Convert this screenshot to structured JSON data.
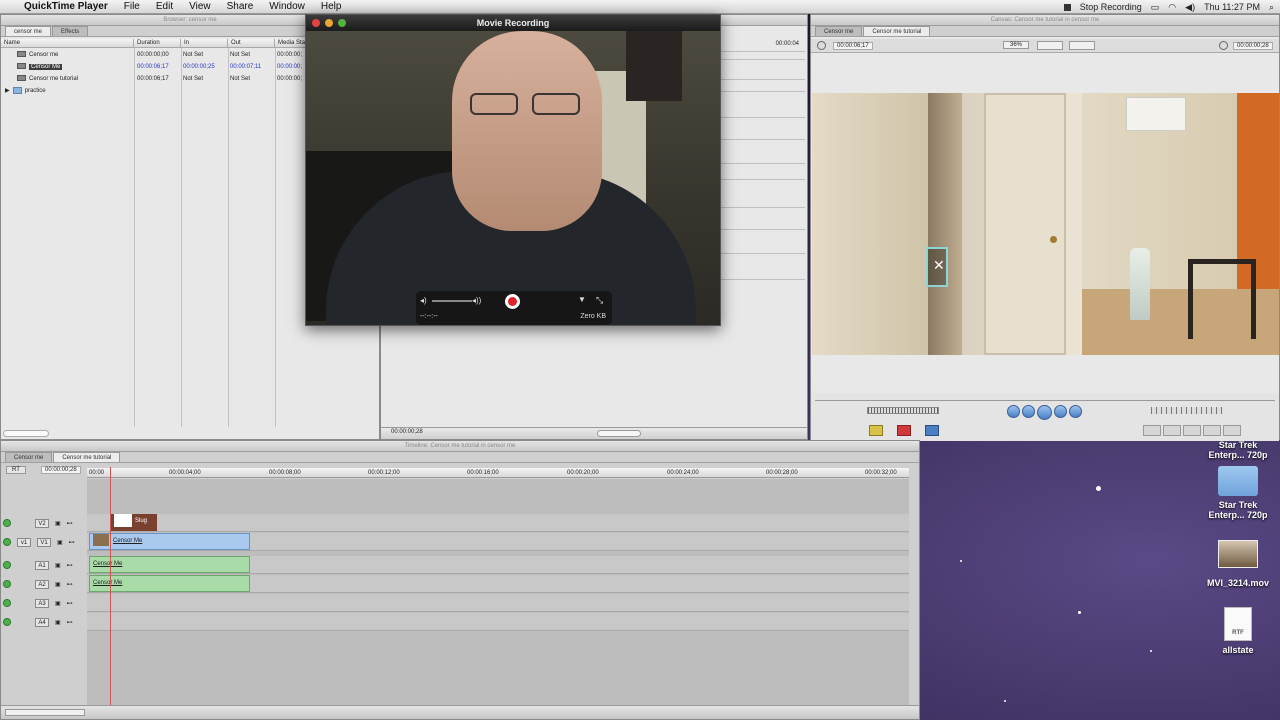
{
  "menubar": {
    "apple": "",
    "items": [
      "QuickTime Player",
      "File",
      "Edit",
      "View",
      "Share",
      "Window",
      "Help"
    ],
    "status": "Stop Recording",
    "clock": "Thu 11:27 PM"
  },
  "browser": {
    "title": "Browser: censor me",
    "tabs": [
      "censor me",
      "Effects"
    ],
    "columns": [
      "Name",
      "Duration",
      "In",
      "Out",
      "Media Start"
    ],
    "rows": [
      {
        "name": "Censor me",
        "duration": "00:00:00;00",
        "in": "Not Set",
        "out": "Not Set",
        "start": "00:00:00;"
      },
      {
        "name": "Censor Me",
        "duration": "00:00:06;17",
        "in": "00:00:00;25",
        "out": "00:00:07;11",
        "start": "00:00:00;"
      },
      {
        "name": "Censor me tutorial",
        "duration": "00:00:06;17",
        "in": "Not Set",
        "out": "Not Set",
        "start": "00:00:00;"
      },
      {
        "name": "practice",
        "duration": "",
        "in": "",
        "out": "",
        "start": ""
      }
    ]
  },
  "viewer": {
    "timecode_top": "00:00:04",
    "timecode_bottom": "00:00:00;28"
  },
  "canvas": {
    "title": "Canvas: Censor me tutorial in censor me",
    "tabs": [
      "Censor me",
      "Censor me tutorial"
    ],
    "timecode_left": "00:00:06;17",
    "zoom": "36%",
    "timecode_right": "00:00:00;28"
  },
  "quicktime": {
    "title": "Movie Recording",
    "time": "--:--:--",
    "size": "Zero KB"
  },
  "timeline": {
    "title": "Timeline: Censor me tutorial in censor me",
    "tabs": [
      "Censor me",
      "Censor me tutorial"
    ],
    "rt": "RT",
    "timecode": "00:00:00;28",
    "ticks": [
      "00:00",
      "00:00:04;00",
      "00:00:08;00",
      "00:00:12;00",
      "00:00:16;00",
      "00:00:20;00",
      "00:00:24;00",
      "00:00:28;00",
      "00:00:32;00"
    ],
    "tracks": [
      "V2",
      "V1",
      "A1",
      "A2",
      "A3",
      "A4"
    ],
    "v1_label": "v1",
    "clips": {
      "slug": "Slug",
      "video": "Censor Me",
      "audio1": "Censor Me",
      "audio2": "Censor Me"
    }
  },
  "desktop": {
    "icons": [
      {
        "label": "Star Trek Enterp... 720p"
      },
      {
        "label": "Star Trek Enterp... 720p"
      },
      {
        "label": "MVI_3214.mov"
      },
      {
        "label": "allstate"
      }
    ],
    "rtf": "RTF"
  },
  "colors": {
    "playhead": "#d25555",
    "video_clip": "#a9c9ef",
    "audio_clip": "#a9dba9",
    "record": "#e0232b"
  }
}
